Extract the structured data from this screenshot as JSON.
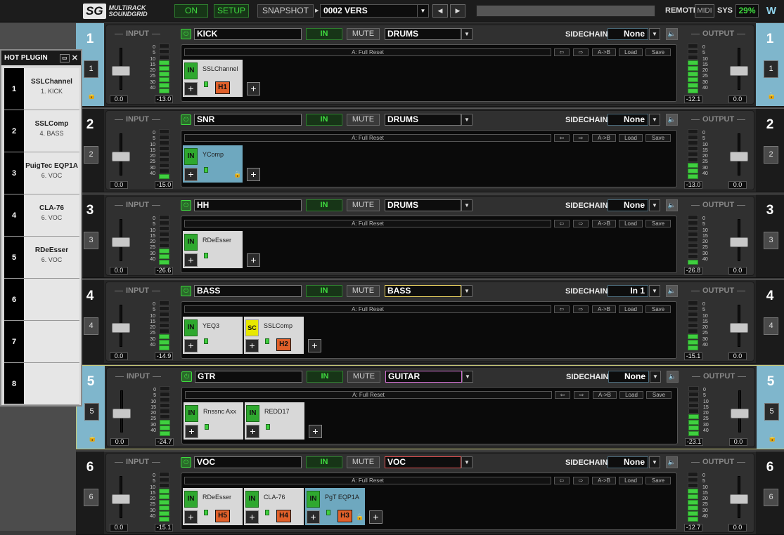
{
  "topbar": {
    "logo_mark": "SG",
    "logo_line1": "MULTIRACK",
    "logo_line2": "SOUNDGRID",
    "on": "ON",
    "setup": "SETUP",
    "snapshot": "SNAPSHOT",
    "snap_name": "0002 VERS",
    "remote": "REMOTE",
    "midi": "MIDI",
    "sys": "SYS",
    "sys_value": "29%"
  },
  "hot_plugin": {
    "title": "HOT PLUGIN",
    "items": [
      {
        "num": "1",
        "name": "SSLChannel",
        "track": "1. KICK"
      },
      {
        "num": "2",
        "name": "SSLComp",
        "track": "4. BASS"
      },
      {
        "num": "3",
        "name": "PuigTec EQP1A",
        "track": "6. VOC"
      },
      {
        "num": "4",
        "name": "CLA-76",
        "track": "6. VOC"
      },
      {
        "num": "5",
        "name": "RDeEsser",
        "track": "6. VOC"
      },
      {
        "num": "6",
        "name": "",
        "track": ""
      },
      {
        "num": "7",
        "name": "",
        "track": ""
      },
      {
        "num": "8",
        "name": "",
        "track": ""
      }
    ]
  },
  "labels": {
    "input": "INPUT",
    "output": "OUTPUT",
    "sidechain": "SIDECHAIN",
    "in": "IN",
    "mute": "MUTE",
    "preset": "A: Full Reset",
    "ab": "A->B",
    "load": "Load",
    "save": "Save",
    "scale": [
      "0",
      "5",
      "10",
      "15",
      "20",
      "25",
      "30",
      "40"
    ]
  },
  "colors": {
    "group_bass": "#e8d060",
    "group_guitar": "#d070d0",
    "group_voc": "#e05050",
    "highlight": "#7fb6cc",
    "meter_green": "#3fcf3f",
    "hot_orange": "#e0602a"
  },
  "tracks": [
    {
      "num": "1",
      "name": "KICK",
      "group": "DRUMS",
      "sidechain": "None",
      "in_val": "0.0",
      "in_peak": "-13.0",
      "out_peak": "-12.1",
      "out_val": "0.0",
      "in_level": 0.72,
      "out_level": 0.72,
      "plugins": [
        {
          "name": "SSLChannel",
          "hot": "H1"
        }
      ]
    },
    {
      "num": "2",
      "name": "SNR",
      "group": "DRUMS",
      "sidechain": "None",
      "in_val": "0.0",
      "in_peak": "-15.0",
      "out_peak": "-13.0",
      "out_val": "0.0",
      "in_level": 0.15,
      "out_level": 0.3,
      "plugins": [
        {
          "name": "YComp",
          "hot": ""
        }
      ]
    },
    {
      "num": "3",
      "name": "HH",
      "group": "DRUMS",
      "sidechain": "None",
      "in_val": "0.0",
      "in_peak": "-26.6",
      "out_peak": "-26.8",
      "out_val": "0.0",
      "in_level": 0.3,
      "out_level": 0.15,
      "plugins": [
        {
          "name": "RDeEsser",
          "hot": ""
        }
      ]
    },
    {
      "num": "4",
      "name": "BASS",
      "group": "BASS",
      "sidechain": "In 1",
      "in_val": "0.0",
      "in_peak": "-14.9",
      "out_peak": "-15.1",
      "out_val": "0.0",
      "in_level": 0.3,
      "out_level": 0.3,
      "plugins": [
        {
          "name": "YEQ3",
          "hot": ""
        },
        {
          "name": "SSLComp",
          "hot": "H2"
        }
      ]
    },
    {
      "num": "5",
      "name": "GTR",
      "group": "GUITAR",
      "sidechain": "None",
      "in_val": "0.0",
      "in_peak": "-24.7",
      "out_peak": "-23.1",
      "out_val": "0.0",
      "in_level": 0.3,
      "out_level": 0.45,
      "plugins": [
        {
          "name": "Rnssnc Axx",
          "hot": ""
        },
        {
          "name": "REDD17",
          "hot": ""
        }
      ]
    },
    {
      "num": "6",
      "name": "VOC",
      "group": "VOC",
      "sidechain": "None",
      "in_val": "0.0",
      "in_peak": "-15.1",
      "out_peak": "-12.7",
      "out_val": "0.0",
      "in_level": 0.72,
      "out_level": 0.72,
      "plugins": [
        {
          "name": "RDeEsser",
          "hot": "H5"
        },
        {
          "name": "CLA-76",
          "hot": "H4"
        },
        {
          "name": "PgT EQP1A",
          "hot": "H3"
        }
      ]
    }
  ]
}
